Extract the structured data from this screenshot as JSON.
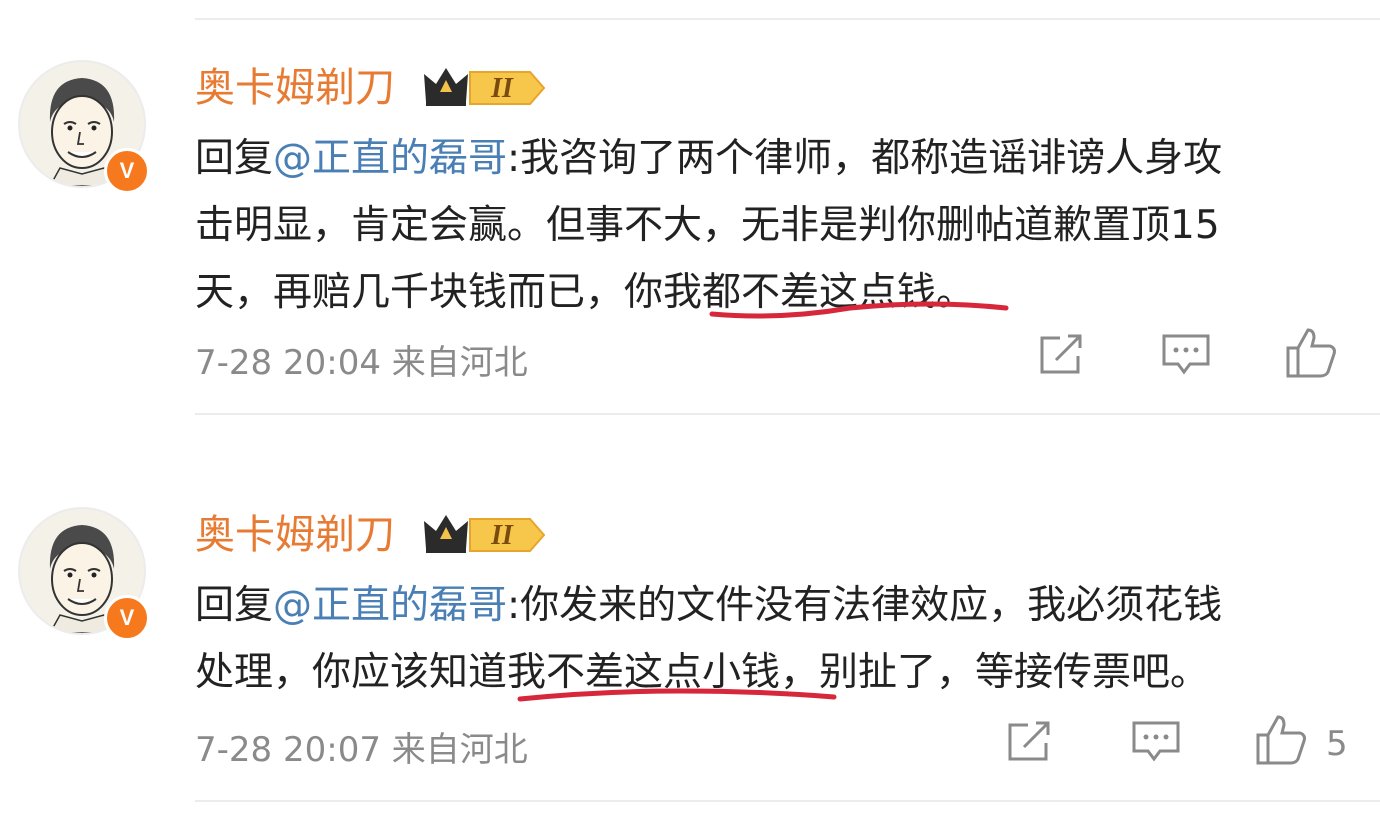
{
  "comments": [
    {
      "author": "奥卡姆剃刀",
      "level": "II",
      "verified": "V",
      "reply_prefix": "回复",
      "mention": "@正直的磊哥",
      "colon": ":",
      "line1": "我咨询了两个律师，都称造谣诽谤人身攻",
      "line2": "击明显，肯定会赢。但事不大，无非是判你删帖道歉置顶15",
      "line3_pre": "天，再赔几千块钱而已，你",
      "line3_hl": "我都不差这点钱",
      "line3_post": "。",
      "time": "7-28 20:04",
      "location": "来自河北",
      "like_count": ""
    },
    {
      "author": "奥卡姆剃刀",
      "level": "II",
      "verified": "V",
      "reply_prefix": "回复",
      "mention": "@正直的磊哥",
      "colon": ":",
      "line1": "你发来的文件没有法律效应，我必须花钱",
      "line2_pre": "处理，你应该知",
      "line2_hl": "道我不差这点小钱",
      "line2_post": "，别扯了，等接传票吧。",
      "time": "7-28 20:07",
      "location": "来自河北",
      "like_count": "5"
    }
  ],
  "colors": {
    "name": "#e87b33",
    "mention": "#4a7fb5",
    "underline": "#d6283a",
    "meta": "#8a8a8a",
    "verified": "#f7791e"
  },
  "icons": [
    "share-icon",
    "comment-icon",
    "like-icon"
  ]
}
